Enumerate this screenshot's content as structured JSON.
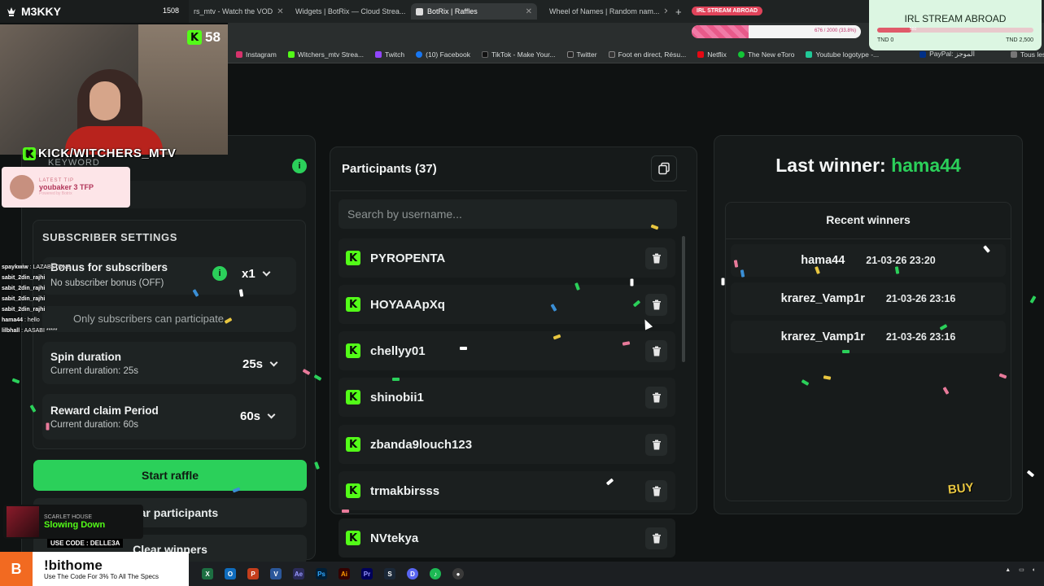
{
  "stream": {
    "brand": "M3KKY",
    "brand_count": "1508",
    "viewers": "58",
    "channel": "KICK/WITCHERS_MTV",
    "tip_label": "LATEST TIP",
    "tip_text": "youbaker 3 TFP",
    "tip_small": "Powered by Botrix",
    "chat": [
      {
        "user": "spaykwiw",
        "msg": "LAZABSTONE"
      },
      {
        "user": "sabit_2din_rajhi",
        "msg": ""
      },
      {
        "user": "sabit_2din_rajhi",
        "msg": ""
      },
      {
        "user": "sabit_2din_rajhi",
        "msg": ""
      },
      {
        "user": "sabit_2din_rajhi",
        "msg": ""
      },
      {
        "user": "hama44",
        "msg": "hello"
      },
      {
        "user": "lilbhall",
        "msg": "AASABI *****"
      }
    ],
    "irl_title": "IRL STREAM ABROAD",
    "irl_low": "TND 0",
    "irl_high": "TND 2,500",
    "irl_bar_mid": "550",
    "irl_pill": "IRL STREAM ABROAD",
    "progress_text": "676 / 2000 (33.8%)",
    "progress_fraction": 0.338,
    "irl_fraction": 0.22,
    "song_label": "SCARLET HOUSE",
    "song_title": "Slowing Down",
    "code": "USE CODE : DELLE3A",
    "ad_title": "!bithome",
    "ad_sub": "Use The Code For 3% To All The Specs",
    "buy": "BUY"
  },
  "browser": {
    "tabs": [
      {
        "label": "rs_mtv - Watch the VOD",
        "color": "#53fc18"
      },
      {
        "label": "Widgets | BotRix — Cloud Strea...",
        "color": "#dddddd"
      },
      {
        "label": "BotRix | Raffles",
        "color": "#dddddd"
      },
      {
        "label": "Wheel of Names | Random nam...",
        "color": "#e94b3c"
      }
    ],
    "bookmarks": [
      {
        "label": "Instagram",
        "color": "#d6336c"
      },
      {
        "label": "Witchers_mtv Strea...",
        "color": "#53fc18"
      },
      {
        "label": "Twitch",
        "color": "#9146ff"
      },
      {
        "label": "(10) Facebook",
        "color": "#1877f2"
      },
      {
        "label": "TikTok - Make Your...",
        "color": "#111111"
      },
      {
        "label": "Twitter",
        "color": "#222222"
      },
      {
        "label": "Foot en direct, Résu...",
        "color": "#333333"
      },
      {
        "label": "Netflix",
        "color": "#e50914"
      },
      {
        "label": "The New eToro",
        "color": "#13c636"
      },
      {
        "label": "Youtube logotype -...",
        "color": "#20c997"
      },
      {
        "label": "PayPal: الموجز",
        "color": "#003087"
      },
      {
        "label": "Tous les favoris",
        "color": "#777777"
      }
    ]
  },
  "left": {
    "keyword_label": "KEYWORD",
    "subscriber_settings": "SUBSCRIBER SETTINGS",
    "bonus_title": "Bonus for subscribers",
    "bonus_sub": "No subscriber bonus (OFF)",
    "bonus_value": "x1",
    "only_subs": "Only subscribers can participate",
    "spin_title": "Spin duration",
    "spin_sub": "Current duration: 25s",
    "spin_value": "25s",
    "reward_title": "Reward claim Period",
    "reward_sub": "Current duration: 60s",
    "reward_value": "60s",
    "start_raffle": "Start raffle",
    "clear_participants": "Clear participants",
    "clear_winners": "Clear winners"
  },
  "participants": {
    "title": "Participants (37)",
    "search_placeholder": "Search by username...",
    "list": [
      "PYROPENTA",
      "HOYAAApXq",
      "chellyy01",
      "shinobii1",
      "zbanda9louch123",
      "trmakbirsss",
      "NVtekya"
    ]
  },
  "winners": {
    "last_prefix": "Last winner: ",
    "last_name": "hama44",
    "recent_title": "Recent winners",
    "recent": [
      {
        "name": "hama44",
        "date": "21-03-26 23:20"
      },
      {
        "name": "krarez_Vamp1r",
        "date": "21-03-26 23:16"
      },
      {
        "name": "krarez_Vamp1r",
        "date": "21-03-26 23:16"
      }
    ]
  },
  "colors": {
    "accent": "#2bd05a",
    "kick_green": "#53fc18",
    "panel": "#161a1a"
  }
}
